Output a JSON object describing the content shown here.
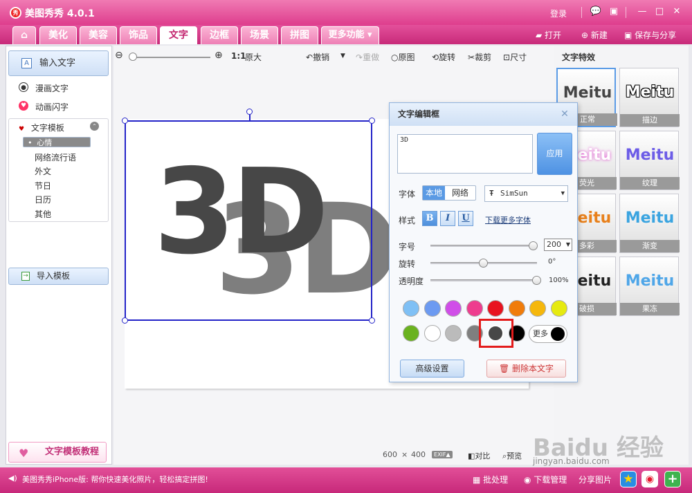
{
  "window": {
    "title": "美图秀秀 4.0.1",
    "logo_text": "秀",
    "login": "登录",
    "controls": {
      "feedback": "💬",
      "skin": "▣",
      "minimize": "—",
      "maximize": "□",
      "close": "✕"
    }
  },
  "tabs": [
    {
      "label": "⌂"
    },
    {
      "label": "美化"
    },
    {
      "label": "美容"
    },
    {
      "label": "饰品"
    },
    {
      "label": "文字",
      "active": true
    },
    {
      "label": "边框"
    },
    {
      "label": "场景"
    },
    {
      "label": "拼图"
    },
    {
      "label": "更多功能 ▾"
    }
  ],
  "topright": {
    "open": "打开",
    "new": "新建",
    "save": "保存与分享"
  },
  "left": {
    "input_text": "输入文字",
    "comic_text": "漫画文字",
    "anim_text": "动画闪字",
    "template_header": "文字模板",
    "template_items": [
      "心情",
      "网络流行语",
      "外文",
      "节日",
      "日历",
      "其他"
    ],
    "import_template": "导入模板",
    "tutorial": "文字模板教程"
  },
  "toolbar": {
    "ratio": "1:1",
    "original_size": "原大",
    "undo": "撤销",
    "redo": "重做",
    "original": "原图",
    "rotate": "旋转",
    "crop": "裁剪",
    "resize": "尺寸"
  },
  "canvas": {
    "fg_text": "3D",
    "bg_text": "3D",
    "fg_color": "#474747",
    "bg_color": "#7e7e7e",
    "width": "600",
    "x": "×",
    "height": "400",
    "exif": "EXIF▲",
    "compare": "对比",
    "preview": "预览"
  },
  "effects": {
    "title": "文字特效",
    "items": [
      {
        "text": "Meitu",
        "label": "正常"
      },
      {
        "text": "Meitu",
        "label": "描边"
      },
      {
        "text": "Meitu",
        "label": "荧光"
      },
      {
        "text": "Meitu",
        "label": "纹理"
      },
      {
        "text": "Meitu",
        "label": "多彩"
      },
      {
        "text": "Meitu",
        "label": "渐变"
      },
      {
        "text": "Meitu",
        "label": "破损"
      },
      {
        "text": "Meitu",
        "label": "果冻"
      }
    ]
  },
  "dialog": {
    "title": "文字编辑框",
    "text_value": "3D",
    "apply": "应用",
    "font_label": "字体",
    "font_local": "本地",
    "font_network": "网络",
    "font_name": "SimSun",
    "style_label": "样式",
    "bold": "B",
    "italic": "I",
    "underline": "U",
    "download_fonts": "下载更多字体",
    "size_label": "字号",
    "size_value": "200",
    "size_level": 0.97,
    "rotate_label": "旋转",
    "rotate_value": "0°",
    "rotate_level": 0.5,
    "opacity_label": "透明度",
    "opacity_value": "100%",
    "opacity_level": 1.0,
    "colors_row1": [
      "#7fc0f5",
      "#6c9af1",
      "#d04ee8",
      "#ee3d8e",
      "#e8131f",
      "#f07c0b",
      "#f5b70c",
      "#e6ea10"
    ],
    "colors_row2": [
      "#6ab21f",
      "#ffffff",
      "#bbbbbb",
      "#7f7f7f",
      "#474747",
      "#000000"
    ],
    "selected_color": "#474747",
    "more": "更多",
    "advanced": "高级设置",
    "delete": "删除本文字"
  },
  "bottom": {
    "status": "美图秀秀iPhone版: 帮你快速美化照片，轻松搞定拼图!",
    "batch": "批处理",
    "download": "下载管理",
    "share": "分享图片"
  },
  "watermark": {
    "logo": "Baidu 经验",
    "url": "jingyan.baidu.com"
  }
}
